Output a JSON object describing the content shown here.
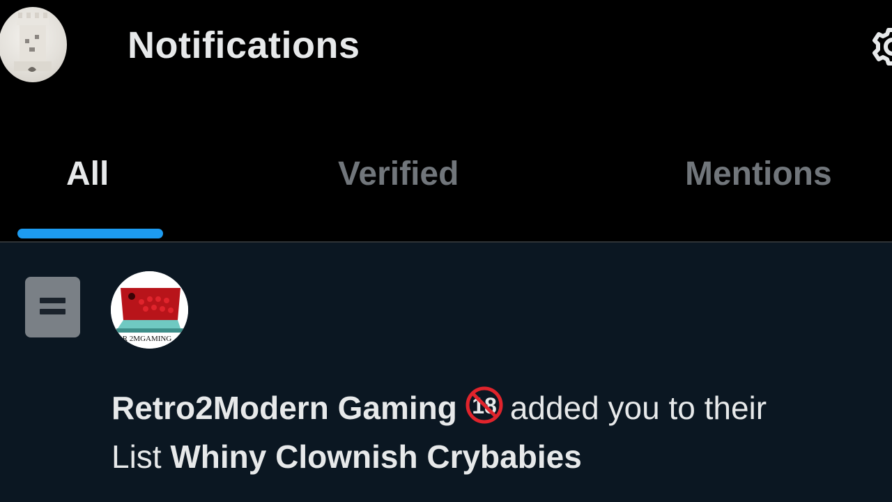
{
  "header": {
    "title": "Notifications",
    "avatar_icon": "rook-avatar-icon",
    "settings_icon": "gear-icon"
  },
  "tabs": [
    {
      "label": "All",
      "active": true
    },
    {
      "label": "Verified",
      "active": false
    },
    {
      "label": "Mentions",
      "active": false
    }
  ],
  "notification": {
    "type_icon": "list-icon",
    "actor_avatar_text": "R 2MGAMING",
    "actor_name": "Retro2Modern Gaming",
    "badge": "18",
    "action_text": "added you to their",
    "list_word": "List",
    "list_name": "Whiny Clownish Crybabies"
  },
  "colors": {
    "accent": "#1d9bf0",
    "background": "#000000",
    "highlight_row": "#0b1722",
    "text_primary": "#e7e9ea",
    "text_secondary": "#71767b"
  }
}
